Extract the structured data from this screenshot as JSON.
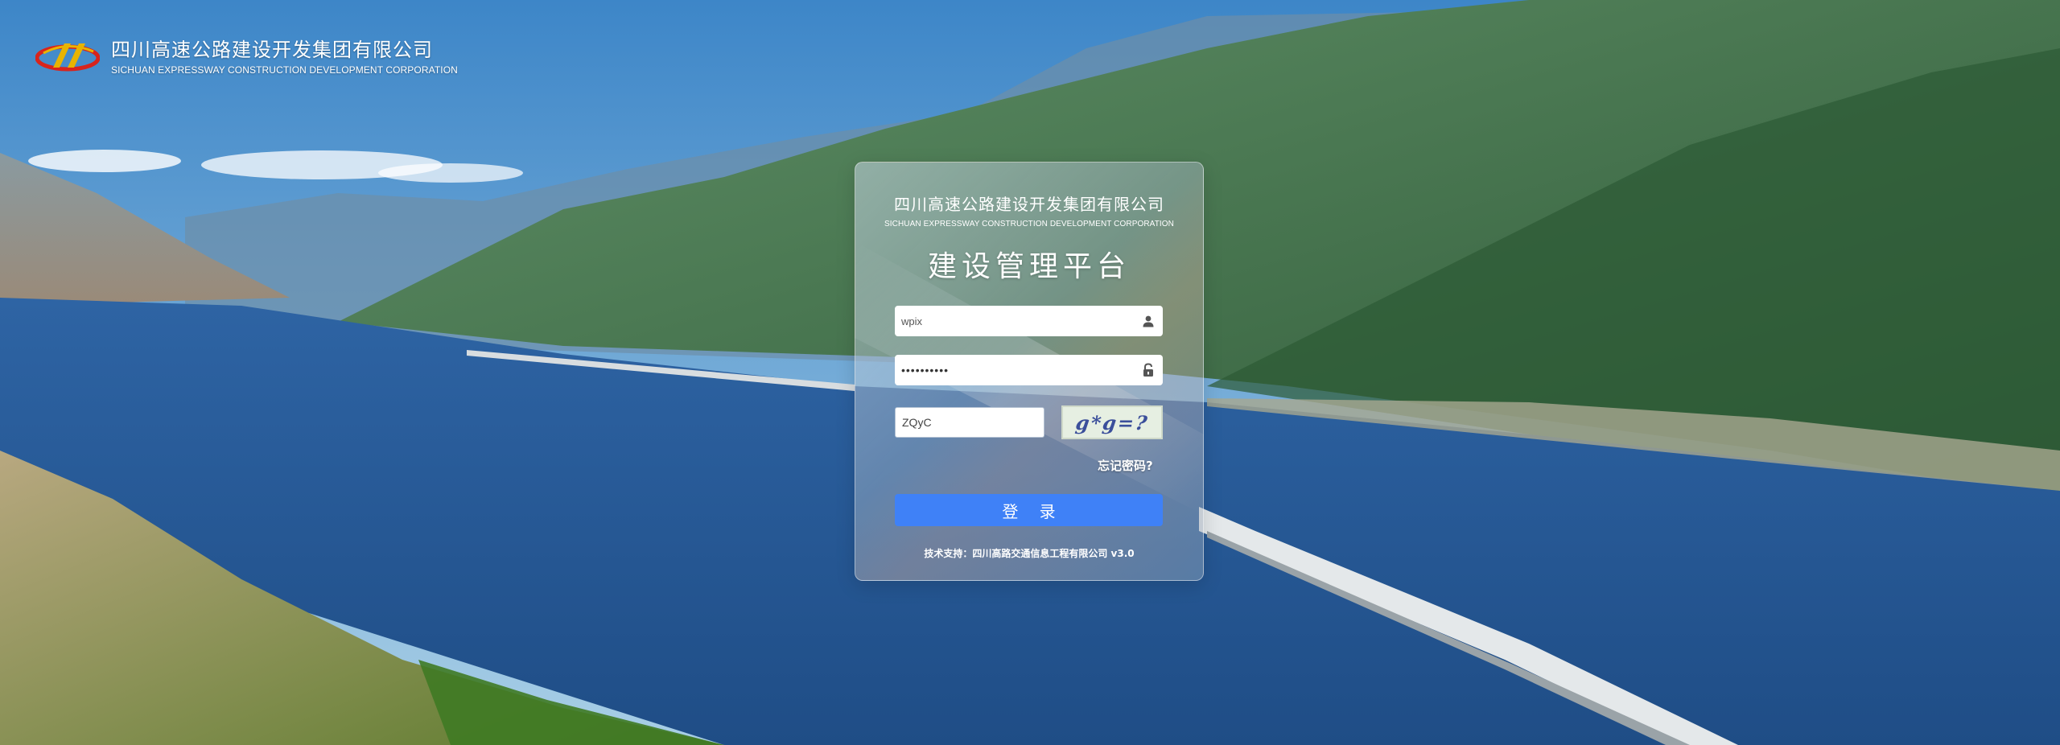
{
  "brand": {
    "name_cn": "四川高速公路建设开发集团有限公司",
    "name_en": "SICHUAN EXPRESSWAY CONSTRUCTION DEVELOPMENT CORPORATION",
    "logo_icon": "company-logo"
  },
  "login": {
    "company_cn": "四川高速公路建设开发集团有限公司",
    "company_en": "SICHUAN EXPRESSWAY CONSTRUCTION DEVELOPMENT CORPORATION",
    "platform_title": "建设管理平台",
    "username_value": "wpix",
    "username_icon": "user-icon",
    "password_value": "••••••••••",
    "password_icon": "lock-icon",
    "captcha_value": "ZQyC",
    "captcha_image_text": "g*g=?",
    "forgot_password": "忘记密码?",
    "login_button": "登 录",
    "footer": "技术支持：四川高路交通信息工程有限公司  v3.0",
    "accent_color": "#3f81f7"
  }
}
